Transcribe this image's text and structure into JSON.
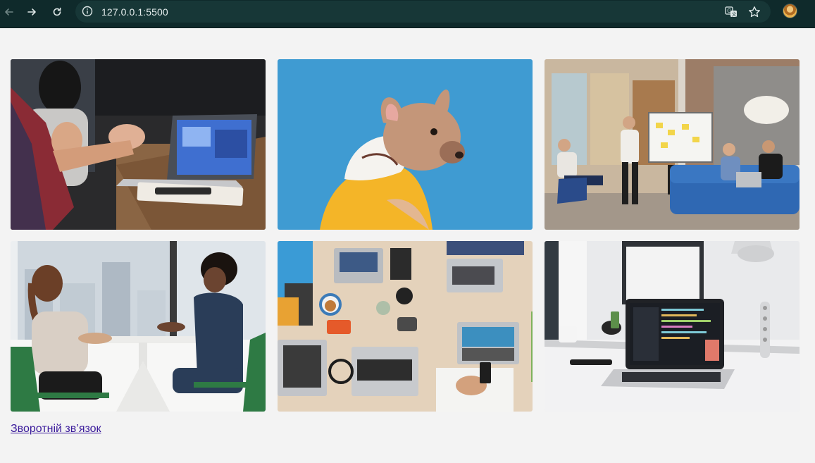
{
  "browser": {
    "url": "127.0.0.1:5500",
    "icons": [
      "back-arrow-icon",
      "forward-arrow-icon",
      "reload-icon",
      "site-info-icon",
      "translate-icon",
      "star-icon",
      "profile-avatar"
    ]
  },
  "gallery": {
    "images": [
      {
        "subject": "office-meeting-laptop"
      },
      {
        "subject": "french-bulldog-yellow-hoodie"
      },
      {
        "subject": "team-presentation-whiteboard"
      },
      {
        "subject": "two-women-at-table"
      },
      {
        "subject": "desk-with-laptops-top-view"
      },
      {
        "subject": "laptop-on-white-desk"
      }
    ]
  },
  "footer": {
    "feedback_link": "Зворотній зв’язок"
  },
  "colors": {
    "chrome_bg": "#0f2a2b",
    "page_bg": "#f3f3f3",
    "link": "#3a1a9b"
  }
}
